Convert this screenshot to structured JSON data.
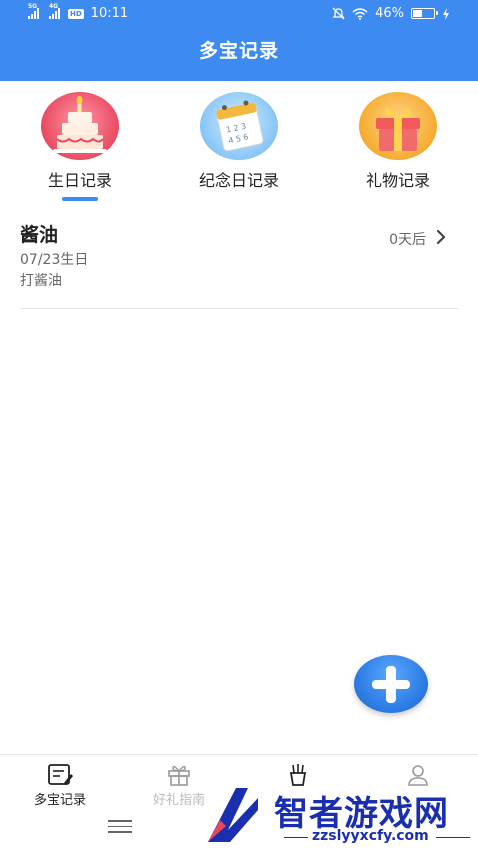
{
  "status_bar": {
    "network_1": "5G",
    "network_2": "4G",
    "hd": "HD",
    "time": "10:11",
    "battery": "46%",
    "battery_level": 0.46
  },
  "header": {
    "title": "多宝记录"
  },
  "tabs": [
    {
      "label": "生日记录",
      "icon": "birthday-cake-icon",
      "active": true
    },
    {
      "label": "纪念日记录",
      "icon": "calendar-icon",
      "active": false
    },
    {
      "label": "礼物记录",
      "icon": "gift-box-icon",
      "active": false
    }
  ],
  "records": [
    {
      "name": "酱油",
      "date": "07/23生日",
      "gift": "打酱油",
      "countdown": "0天后"
    }
  ],
  "fab": {
    "icon": "plus-icon"
  },
  "bottom_nav": [
    {
      "label": "多宝记录",
      "icon": "notebook-icon",
      "active": true
    },
    {
      "label": "好礼指南",
      "icon": "gift-icon",
      "active": false
    },
    {
      "label": "",
      "icon": "fries-icon",
      "active": false
    },
    {
      "label": "",
      "icon": "user-icon",
      "active": false
    }
  ],
  "watermark": {
    "text": "智者游戏网",
    "url": "zzslyyxcfy.com"
  },
  "colors": {
    "primary": "#3d8bf0",
    "fab": "#2f7fe6",
    "watermark": "#1a2fb0"
  }
}
